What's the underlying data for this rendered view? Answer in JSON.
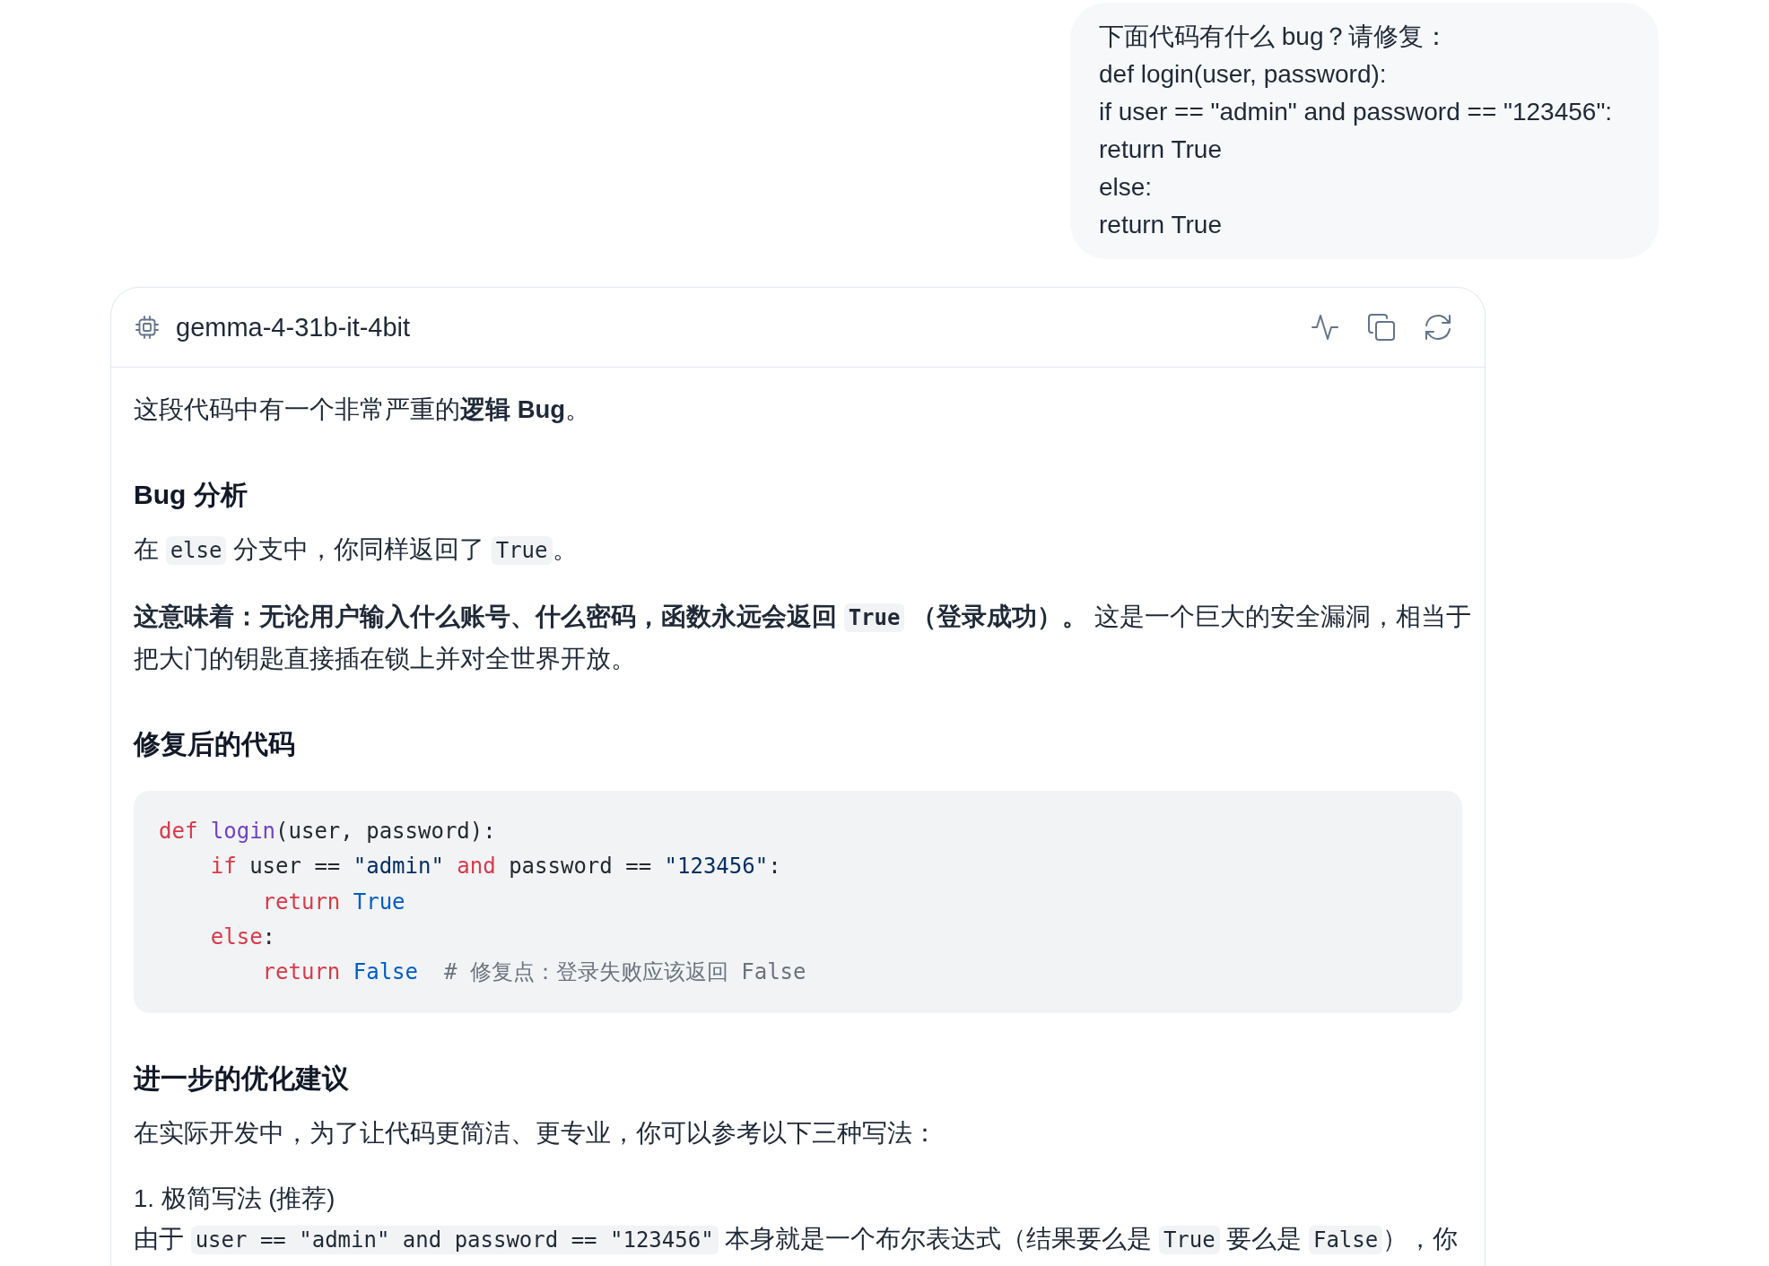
{
  "user_message": {
    "lines": [
      "下面代码有什么 bug？请修复：",
      "def login(user, password):",
      "if user == \"admin\" and password == \"123456\":",
      "return True",
      "else:",
      "return True"
    ]
  },
  "response": {
    "model_name": "gemma-4-31b-it-4bit",
    "blocks": [
      {
        "kind": "paragraph",
        "segments": [
          {
            "kind": "text",
            "text": "这段代码中有一个非常严重的**逻辑 Bug**。"
          }
        ]
      },
      {
        "kind": "heading",
        "text": "Bug 分析"
      },
      {
        "kind": "paragraph",
        "segments": [
          {
            "kind": "text",
            "text": "在 "
          },
          {
            "kind": "code",
            "text": "else"
          },
          {
            "kind": "text",
            "text": " 分支中，你同样返回了 "
          },
          {
            "kind": "code",
            "text": "True"
          },
          {
            "kind": "text",
            "text": "。"
          }
        ]
      },
      {
        "kind": "paragraph",
        "segments": [
          {
            "kind": "text",
            "text": "**这意味着：无论用户输入什么账号、什么密码，函数永远会返回** "
          },
          {
            "kind": "code",
            "text": "**True**"
          },
          {
            "kind": "text",
            "text": " **（登录成功）。** 这是一个巨大的安全漏洞，相当于把大门的钥匙直接插在锁上并对全世界开放。"
          }
        ]
      },
      {
        "kind": "heading",
        "text": "修复后的代码"
      },
      {
        "kind": "code",
        "lines": [
          {
            "tokens": [
              {
                "kind": "keyword",
                "text": "def "
              },
              {
                "kind": "function",
                "text": "login"
              },
              {
                "kind": "plain",
                "text": "(user, password):"
              }
            ],
            "children": [
              {
                "tokens": [
                  {
                    "kind": "keyword",
                    "text": "if "
                  },
                  {
                    "kind": "plain",
                    "text": "user == "
                  },
                  {
                    "kind": "string",
                    "text": "\"admin\" "
                  },
                  {
                    "kind": "keyword",
                    "text": "and "
                  },
                  {
                    "kind": "plain",
                    "text": "password == "
                  },
                  {
                    "kind": "string",
                    "text": "\"123456\""
                  },
                  {
                    "kind": "plain",
                    "text": ":"
                  }
                ],
                "children": [
                  {
                    "tokens": [
                      {
                        "kind": "keyword",
                        "text": "return "
                      },
                      {
                        "kind": "constant",
                        "text": "True"
                      }
                    ]
                  }
                ]
              },
              {
                "tokens": [
                  {
                    "kind": "keyword",
                    "text": "else"
                  },
                  {
                    "kind": "plain",
                    "text": ":"
                  }
                ],
                "children": [
                  {
                    "tokens": [
                      {
                        "kind": "keyword",
                        "text": "return "
                      },
                      {
                        "kind": "constant",
                        "text": "False  "
                      },
                      {
                        "kind": "comment",
                        "text": "# 修复点：登录失败应该返回 False"
                      }
                    ]
                  }
                ]
              }
            ]
          }
        ]
      },
      {
        "kind": "heading",
        "text": "进一步的优化建议"
      },
      {
        "kind": "paragraph",
        "segments": [
          {
            "kind": "text",
            "text": "在实际开发中，为了让代码更简洁、更专业，你可以参考以下三种写法："
          }
        ]
      },
      {
        "kind": "label",
        "text": "1. 极简写法 (推荐)"
      },
      {
        "kind": "paragraph",
        "segments": [
          {
            "kind": "text",
            "text": "由于 "
          },
          {
            "kind": "code",
            "text": "user == \"admin\" and password == \"123456\""
          },
          {
            "kind": "text",
            "text": " 本身就是一个布尔表达式（结果要么是 "
          },
          {
            "kind": "code",
            "text": "True"
          },
          {
            "kind": "text",
            "text": " 要么是 "
          },
          {
            "kind": "code",
            "text": "False"
          },
          {
            "kind": "text",
            "text": "），你"
          }
        ]
      }
    ]
  }
}
